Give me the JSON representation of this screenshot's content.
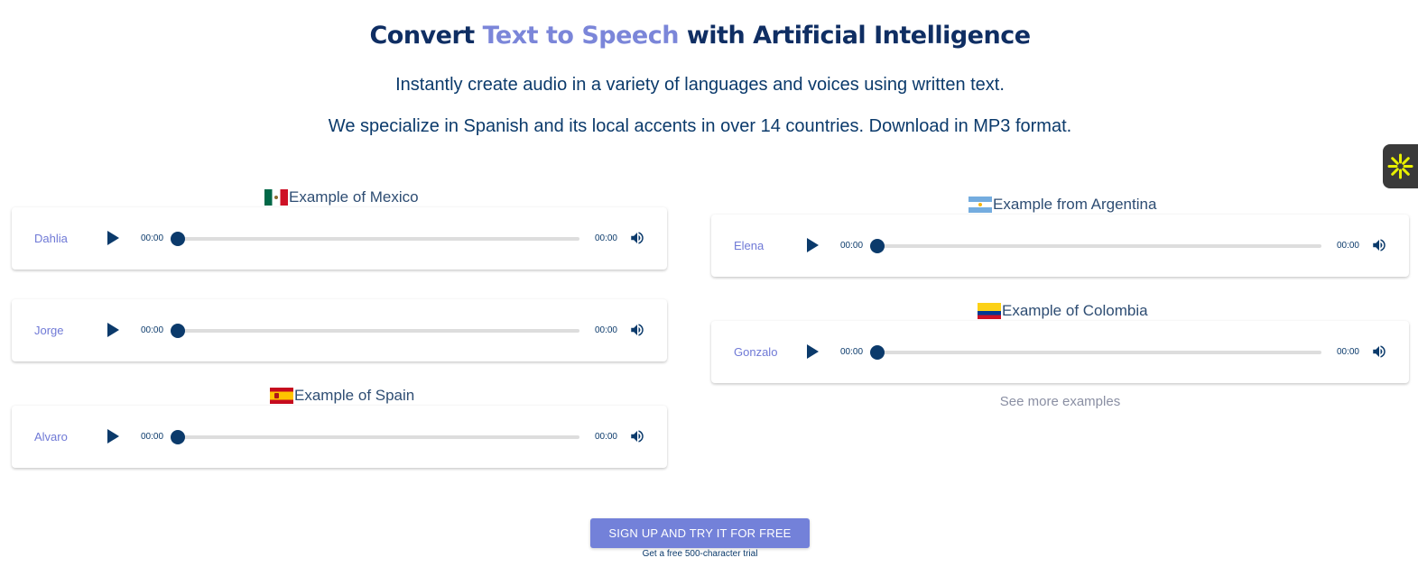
{
  "hero": {
    "title_part1": "Convert ",
    "title_accent": "Text to Speech",
    "title_part2": " with Artificial Intelligence",
    "subtitle1": "Instantly create audio in a variety of languages and voices using written text.",
    "subtitle2": "We specialize in Spanish and its local accents in over 14 countries. Download in MP3 format."
  },
  "sections": {
    "mexico": "Example of Mexico",
    "spain": "Example of Spain",
    "argentina": "Example from Argentina",
    "colombia": "Example of Colombia"
  },
  "players": {
    "dahlia": {
      "name": "Dahlia",
      "current": "00:00",
      "duration": "00:00",
      "progress": 0
    },
    "jorge": {
      "name": "Jorge",
      "current": "00:00",
      "duration": "00:00",
      "progress": 0
    },
    "alvaro": {
      "name": "Alvaro",
      "current": "00:00",
      "duration": "00:00",
      "progress": 0
    },
    "elena": {
      "name": "Elena",
      "current": "00:00",
      "duration": "00:00",
      "progress": 0
    },
    "gonzalo": {
      "name": "Gonzalo",
      "current": "00:00",
      "duration": "00:00",
      "progress": 0
    }
  },
  "icons": {
    "play": "play-icon",
    "volume": "volume-icon",
    "accessibility": "asterisk-icon"
  },
  "links": {
    "see_more": "See more examples"
  },
  "cta": {
    "label": "SIGN UP AND TRY IT FOR FREE",
    "note": "Get a free 500-character trial"
  },
  "colors": {
    "accent": "#7381d9",
    "primary": "#0b3a6b",
    "widget": "#3a3a3a",
    "widget_icon": "#e8f000"
  }
}
